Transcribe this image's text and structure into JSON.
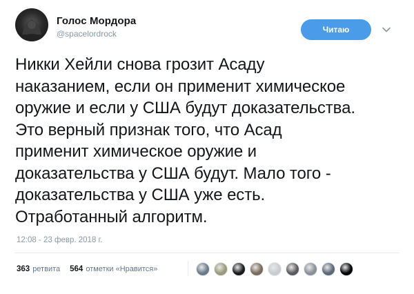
{
  "user": {
    "display_name": "Голос Мордора",
    "handle": "@spacelordrock"
  },
  "follow_button": {
    "label": "Читаю",
    "color": "#4a9ce8"
  },
  "menu_icon": "chevron-down-icon",
  "tweet": {
    "text": "Никки Хейли снова грозит Асаду\nнаказанием, если он применит химическое\nоружие и если у США будут доказательства.\nЭто верный признак того, что Асад\nприменит химическое оружие и\nдоказательства у США будут. Мало того -\nдоказательства у США уже есть.\nОтработанный алгоритм.",
    "timestamp": "12:08 - 23 февр. 2018 г."
  },
  "stats": {
    "retweets_count": "363",
    "retweets_label": "ретвита",
    "likes_count": "564",
    "likes_label": "отметки «Нравится»"
  },
  "likers": [
    {
      "name": "liker-avatar-1",
      "color": "#6b7a8a"
    },
    {
      "name": "liker-avatar-2",
      "color": "#9a9a7a"
    },
    {
      "name": "liker-avatar-3",
      "color": "#1a1a1a"
    },
    {
      "name": "liker-avatar-4",
      "color": "#7a6a5a"
    },
    {
      "name": "liker-avatar-5",
      "color": "#c8ccd0"
    },
    {
      "name": "liker-avatar-6",
      "color": "#5a5a5a"
    },
    {
      "name": "liker-avatar-7",
      "color": "#8a9098"
    },
    {
      "name": "liker-avatar-8",
      "color": "#5a6878"
    },
    {
      "name": "liker-avatar-9",
      "color": "#000000"
    }
  ]
}
